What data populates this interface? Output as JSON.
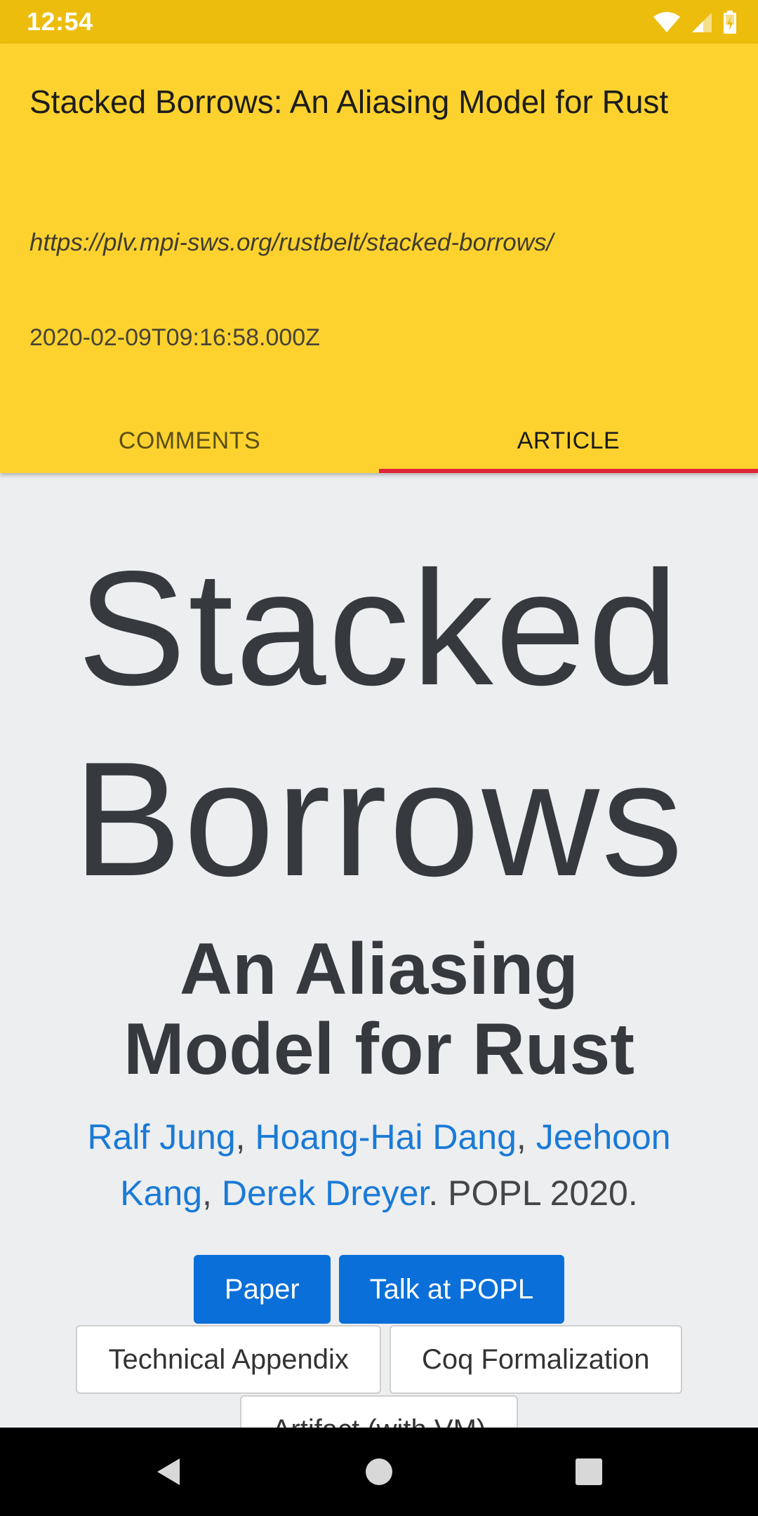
{
  "status_bar": {
    "time": "12:54",
    "icons": [
      "wifi-icon",
      "signal-icon",
      "battery-icon"
    ]
  },
  "header": {
    "title": "Stacked Borrows: An Aliasing Model for Rust",
    "url": "https://plv.mpi-sws.org/rustbelt/stacked-borrows/",
    "date": "2020-02-09T09:16:58.000Z"
  },
  "tabs": [
    {
      "label": "COMMENTS",
      "selected": false
    },
    {
      "label": "ARTICLE",
      "selected": true
    }
  ],
  "article": {
    "title": "Stacked Borrows",
    "subtitle": "An Aliasing Model for Rust",
    "authors": [
      "Ralf Jung",
      "Hoang-Hai Dang",
      "Jeehoon Kang",
      "Derek Dreyer"
    ],
    "separator": ", ",
    "venue": ". POPL 2020.",
    "primary_buttons": [
      "Paper",
      "Talk at POPL"
    ],
    "secondary_buttons": [
      "Technical Appendix",
      "Coq Formalization"
    ],
    "partial_button": "Artifact (with VM)"
  },
  "colors": {
    "status_bar": "#ecbd0c",
    "header": "#fdd22f",
    "tab_indicator": "#e0263a",
    "link": "#1a7ad6",
    "primary_button": "#0a6fd8"
  },
  "nav_bar": [
    "back-icon",
    "home-icon",
    "recents-icon"
  ]
}
